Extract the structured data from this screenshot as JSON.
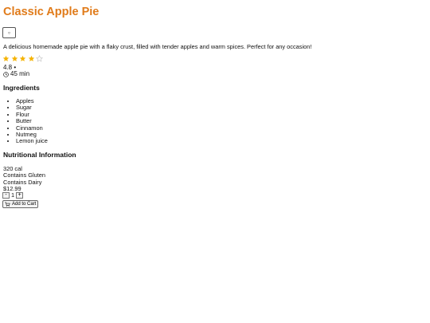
{
  "recipe": {
    "title": "Classic Apple Pie",
    "description": "A delicious homemade apple pie with a flaky crust, filled with tender apples and warm spices. Perfect for any occasion!",
    "rating": 4.8,
    "rating_separator": "•",
    "stars_filled": 4,
    "stars_total": 5,
    "time": "45 min"
  },
  "ingredients": {
    "heading": "Ingredients",
    "items": [
      "Apples",
      "Sugar",
      "Flour",
      "Butter",
      "Cinnamon",
      "Nutmeg",
      "Lemon juice"
    ]
  },
  "nutrition": {
    "heading": "Nutritional Information",
    "calories": "320 cal",
    "allergens": [
      "Contains Gluten",
      "Contains Dairy"
    ]
  },
  "purchase": {
    "price": "$12.99",
    "quantity": "1",
    "decrement_label": "-",
    "increment_label": "+",
    "add_to_cart_label": "Add to Cart"
  },
  "icons": {
    "favorite": "heart-outline-icon",
    "star": "star-icon",
    "time": "clock-icon",
    "cart": "shopping-cart-icon"
  },
  "colors": {
    "title": "#e07b1a",
    "star_filled": "#f5b301",
    "star_empty": "#c8c8c8"
  }
}
